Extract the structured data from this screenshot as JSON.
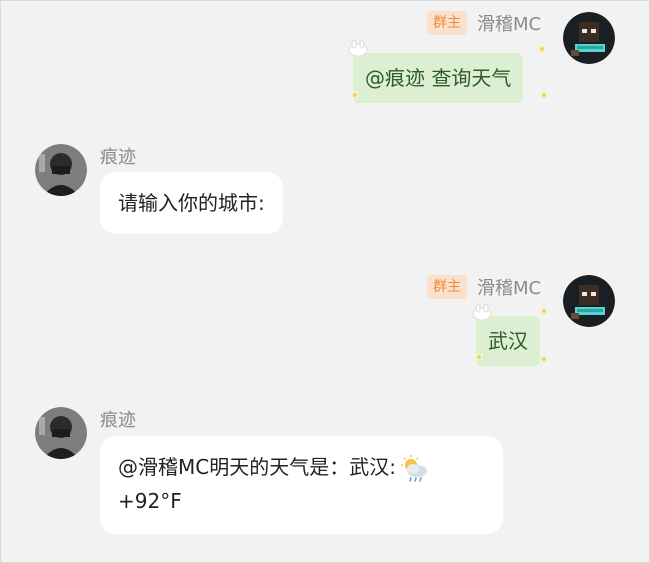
{
  "messages": [
    {
      "side": "right",
      "sender": "滑稽MC",
      "badge": "群主",
      "lines": [
        "@痕迹 查询天气"
      ]
    },
    {
      "side": "left",
      "sender": "痕迹",
      "lines": [
        "请输入你的城市:"
      ]
    },
    {
      "side": "right",
      "sender": "滑稽MC",
      "badge": "群主",
      "lines": [
        "武汉"
      ]
    },
    {
      "side": "left",
      "sender": "痕迹",
      "lines": [
        "@滑稽MC明天的天气是：武汉:",
        "+92°F"
      ],
      "icon": "cloud-rain-sun-icon"
    }
  ],
  "colors": {
    "background": "#f2f2f2",
    "bubble_left": "#ffffff",
    "bubble_right": "#dcefd2",
    "bubble_right_text": "#2f5a2a",
    "badge_bg": "#fbe1cc",
    "badge_text": "#f08a3c",
    "name_text": "#8a8a8a"
  }
}
